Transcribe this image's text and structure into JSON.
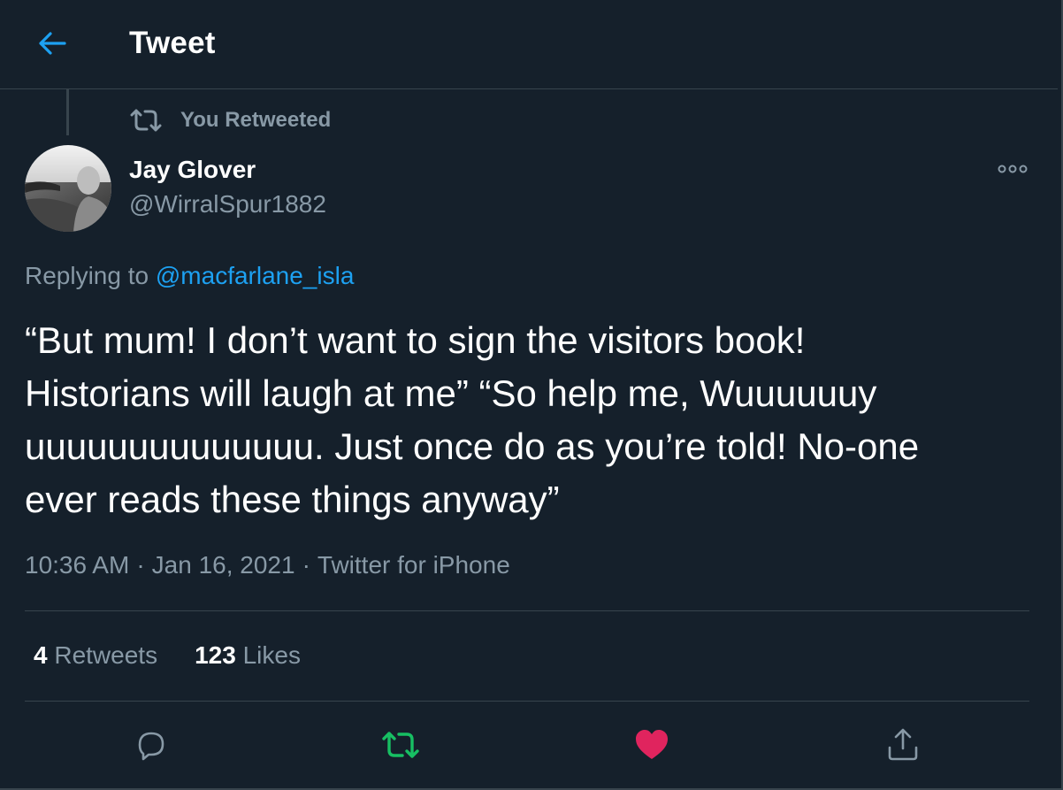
{
  "header": {
    "title": "Tweet",
    "back_icon": "arrow-left-icon"
  },
  "context": {
    "label": "You Retweeted",
    "icon": "retweet-icon"
  },
  "author": {
    "name": "Jay Glover",
    "handle": "@WirralSpur1882"
  },
  "replying": {
    "prefix": "Replying to ",
    "handle": "@macfarlane_isla"
  },
  "tweet": {
    "text": "“But mum! I don’t want to sign the visitors book!\nHistorians will laugh at me” “So help me, Wuuuuuuy\nuuuuuuuuuuuuuu. Just once do as you’re told! No-one\never reads these things anyway”"
  },
  "meta": {
    "time": "10:36 AM",
    "sep1": "·",
    "date": "Jan 16, 2021",
    "sep2": "·",
    "source": "Twitter for iPhone"
  },
  "stats": {
    "retweets_count": "4",
    "retweets_label": "Retweets",
    "likes_count": "123",
    "likes_label": "Likes"
  },
  "actions": [
    "reply-icon",
    "retweet-icon",
    "like-icon",
    "share-icon"
  ],
  "colors": {
    "background": "#15202b",
    "accent": "#1da1f2",
    "secondary_text": "#8899a6",
    "retweet_active": "#17bf63",
    "like_active": "#e0245e",
    "border": "#38444d"
  }
}
